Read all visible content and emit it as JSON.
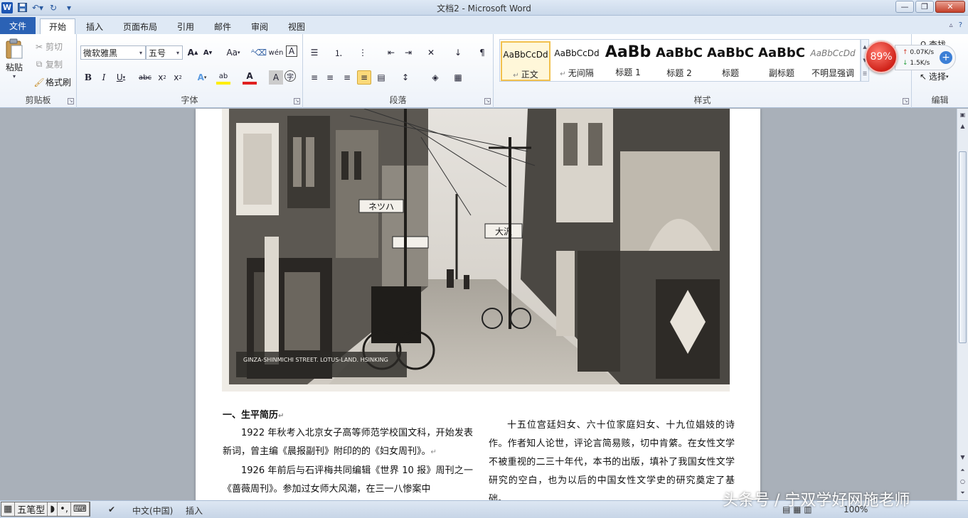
{
  "window": {
    "title": "文档2 - Microsoft Word"
  },
  "tabs": [
    "文件",
    "开始",
    "插入",
    "页面布局",
    "引用",
    "邮件",
    "审阅",
    "视图"
  ],
  "clipboard": {
    "paste": "粘贴",
    "cut": "剪切",
    "copy": "复制",
    "format_painter": "格式刷",
    "label": "剪贴板"
  },
  "font": {
    "family": "微软雅黑",
    "size": "五号",
    "label": "字体",
    "aa": "Aa"
  },
  "paragraph": {
    "label": "段落"
  },
  "styles": {
    "label": "样式",
    "items": [
      {
        "sample": "AaBbCcDd",
        "name": "正文"
      },
      {
        "sample": "AaBbCcDd",
        "name": "无间隔"
      },
      {
        "sample": "AaBb",
        "name": "标题 1"
      },
      {
        "sample": "AaBbC",
        "name": "标题 2"
      },
      {
        "sample": "AaBbC",
        "name": "标题"
      },
      {
        "sample": "AaBbC",
        "name": "副标题"
      },
      {
        "sample": "AaBbCcDd",
        "name": "不明显强调"
      }
    ]
  },
  "editing": {
    "find": "查找",
    "select": "选择",
    "label": "编辑"
  },
  "net_widget": {
    "percent": "89%",
    "up": "0.07K/s",
    "down": "1.5K/s"
  },
  "photo": {
    "caption_en": "GINZA-SHINMICHI STREET. LOTUS-LAND. HSINKING",
    "sign_1": "ネツハ",
    "sign_2": "大沢"
  },
  "document": {
    "heading": "一、生平简历",
    "left_paragraphs": [
      "1922 年秋考入北京女子高等师范学校国文科，开始发表新词，曾主编《晨报副刊》附印的的《妇女周刊》。",
      "1926 年前后与石评梅共同编辑《世界 10 报》周刊之一《蔷薇周刊》。参加过女师大风潮，在三一八惨案中"
    ],
    "right_paragraph": "十五位宫廷妇女、六十位家庭妇女、十九位娼妓的诗作。作者知人论世，评论言简易赅，切中肯綮。在女性文学不被重视的二三十年代，本书的出版，填补了我国女性文学研究的空白，也为以后的中国女性文学史的研究奠定了基础。"
  },
  "statusbar": {
    "ime_name": "五笔型",
    "language": "中文(中国)",
    "mode": "插入",
    "zoom": "100%"
  },
  "watermark": "头条号 / 宁双学好网施老师"
}
